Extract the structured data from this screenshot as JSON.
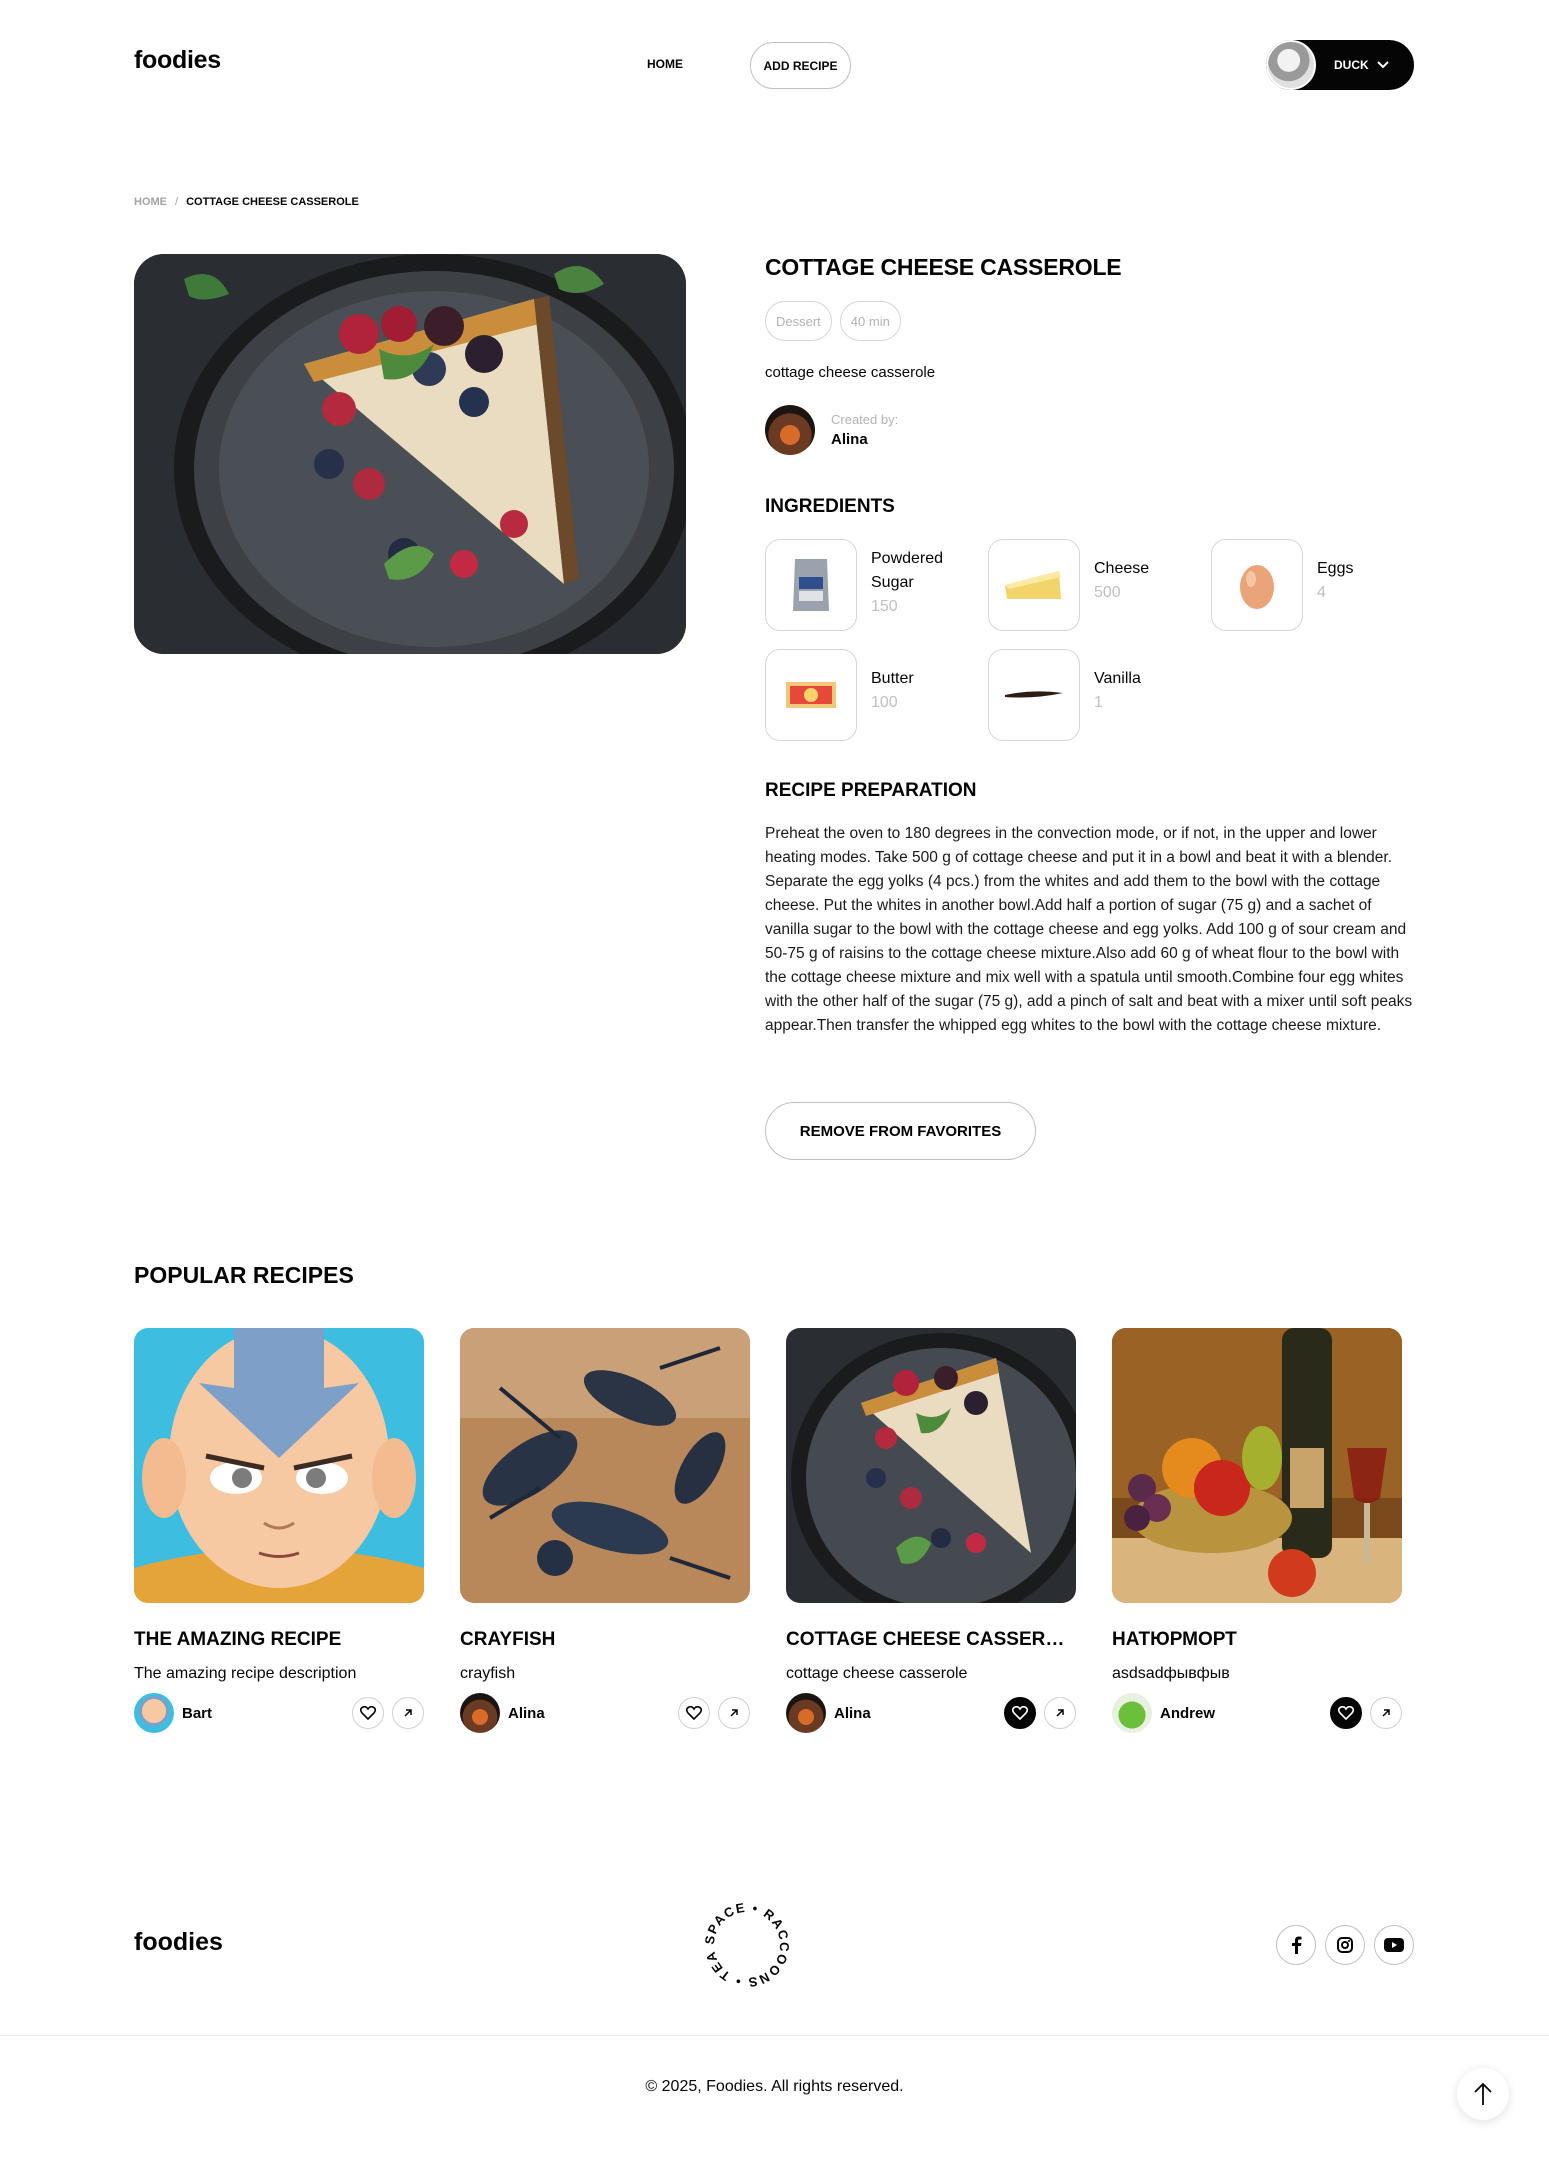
{
  "header": {
    "logo": "foodies",
    "nav": {
      "home": "HOME",
      "add_recipe": "ADD RECIPE"
    },
    "user": {
      "name": "DUCK"
    }
  },
  "breadcrumb": {
    "home": "HOME",
    "separator": "/",
    "current": "COTTAGE CHEESE CASSEROLE"
  },
  "recipe": {
    "title": "COTTAGE CHEESE CASSEROLE",
    "tags": [
      "Dessert",
      "40 min"
    ],
    "description": "cottage cheese casserole",
    "author_label": "Created by:",
    "author_name": "Alina",
    "ingredients_heading": "INGREDIENTS",
    "ingredients": [
      {
        "name": "Powdered Sugar",
        "qty": "150",
        "icon": "sugar-bag-icon"
      },
      {
        "name": "Cheese",
        "qty": "500",
        "icon": "cheese-icon"
      },
      {
        "name": "Eggs",
        "qty": "4",
        "icon": "egg-icon"
      },
      {
        "name": "Butter",
        "qty": "100",
        "icon": "butter-icon"
      },
      {
        "name": "Vanilla",
        "qty": "1",
        "icon": "vanilla-icon"
      }
    ],
    "preparation_heading": "RECIPE PREPARATION",
    "preparation": "Preheat the oven to 180 degrees in the convection mode, or if not, in the upper and lower heating modes. Take 500 g of cottage cheese and put it in a bowl and beat it with a blender. Separate the egg yolks (4 pcs.) from the whites and add them to the bowl with the cottage cheese. Put the whites in another bowl.Add half a portion of sugar (75 g) and a sachet of vanilla sugar to the bowl with the cottage cheese and egg yolks. Add 100 g of sour cream and 50-75 g of raisins to the cottage cheese mixture.Also add 60 g of wheat flour to the bowl with the cottage cheese mixture and mix well with a spatula until smooth.Combine four egg whites with the other half of the sugar (75 g), add a pinch of salt and beat with a mixer until soft peaks appear.Then transfer the whipped egg whites to the bowl with the cottage cheese mixture.",
    "remove_favorite": "REMOVE FROM FAVORITES"
  },
  "popular": {
    "heading": "POPULAR RECIPES",
    "cards": [
      {
        "title": "THE AMAZING RECIPE",
        "description": "The amazing recipe description",
        "author": "Bart",
        "favorite": false
      },
      {
        "title": "CRAYFISH",
        "description": "crayfish",
        "author": "Alina",
        "favorite": false
      },
      {
        "title": "COTTAGE CHEESE CASSEROLE",
        "description": "cottage cheese casserole",
        "author": "Alina",
        "favorite": true
      },
      {
        "title": "НАТЮРМОРТ",
        "description": "asdsadфывфыв",
        "author": "Andrew",
        "favorite": true
      }
    ]
  },
  "footer": {
    "logo": "foodies",
    "badge_text": "SPACE • RACCOONS • TEAM •",
    "socials": [
      "facebook-icon",
      "instagram-icon",
      "youtube-icon"
    ],
    "copyright": "© 2025, Foodies. All rights reserved."
  },
  "colors": {
    "text": "#050505",
    "muted": "#bfbfbf",
    "border": "#d6d6d6",
    "dark": "#050505"
  }
}
